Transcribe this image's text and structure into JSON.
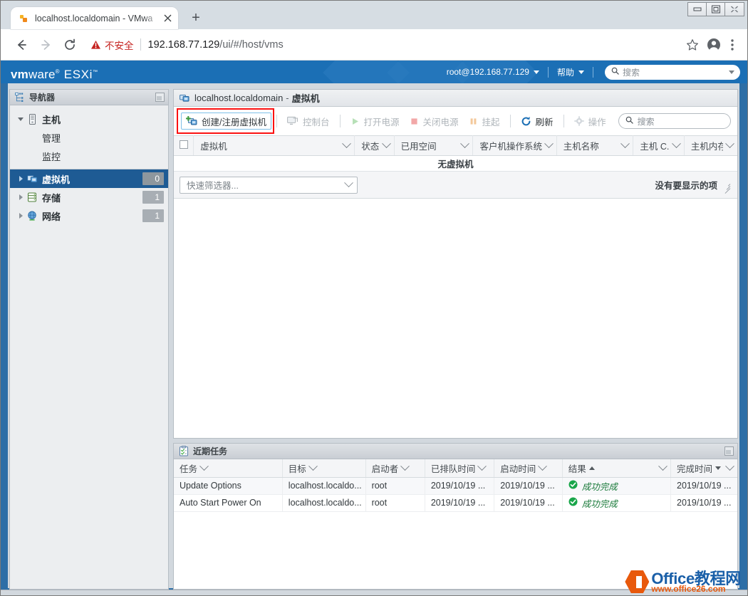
{
  "browser": {
    "tab": {
      "title": "localhost.localdomain - VMwa",
      "favicon_icon": "vmware-favicon-icon",
      "close_icon": "close-icon"
    },
    "new_tab_label": "+",
    "window_controls": {
      "minimize": "minimize-icon",
      "maximize": "maximize-icon",
      "close": "close-icon"
    },
    "nav": {
      "back_icon": "back-arrow-icon",
      "forward_icon": "forward-arrow-icon",
      "reload_icon": "reload-icon"
    },
    "omnibox": {
      "warning_icon": "warning-triangle-icon",
      "security_text": "不安全",
      "url_host": "192.168.77.129",
      "url_path": "/ui/#/host/vms"
    },
    "actions": {
      "bookmark_icon": "star-icon",
      "profile_icon": "account-avatar-icon",
      "menu_icon": "three-dot-menu-icon"
    }
  },
  "esxi_header": {
    "brand_vm": "vm",
    "brand_ware": "ware",
    "brand_reg": "®",
    "brand_product": "ESXi",
    "brand_tm": "™",
    "user": "root@192.168.77.129",
    "help": "帮助",
    "search_placeholder": "搜索",
    "search_icon": "search-icon",
    "accent_color": "#1b6fb5"
  },
  "navigator": {
    "title": "导航器",
    "title_icon": "navigator-icon",
    "minimize_icon": "panel-minimize-icon",
    "host": {
      "label": "主机",
      "icon": "host-server-icon",
      "expand_icon": "triangle-down-icon",
      "children": [
        {
          "label": "管理"
        },
        {
          "label": "监控"
        }
      ]
    },
    "items": [
      {
        "label": "虚拟机",
        "icon": "virtual-machine-icon",
        "count": "0",
        "selected": true
      },
      {
        "label": "存储",
        "icon": "storage-icon",
        "count": "1",
        "selected": false
      },
      {
        "label": "网络",
        "icon": "network-globe-icon",
        "count": "1",
        "selected": false
      }
    ]
  },
  "content": {
    "breadcrumb": {
      "icon": "virtual-machine-icon",
      "host": "localhost.localdomain",
      "separator": "-",
      "section": "虚拟机"
    },
    "toolbar": [
      {
        "label": "创建/注册虚拟机",
        "icon": "create-vm-icon",
        "disabled": false,
        "highlighted": true
      },
      {
        "label": "控制台",
        "icon": "console-icon",
        "disabled": true,
        "highlighted": false
      },
      {
        "label": "打开电源",
        "icon": "power-on-icon",
        "disabled": true,
        "highlighted": false
      },
      {
        "label": "关闭电源",
        "icon": "power-off-icon",
        "disabled": true,
        "highlighted": false
      },
      {
        "label": "挂起",
        "icon": "suspend-icon",
        "disabled": true,
        "highlighted": false
      },
      {
        "label": "刷新",
        "icon": "refresh-icon",
        "disabled": false,
        "highlighted": false
      },
      {
        "label": "操作",
        "icon": "actions-gear-icon",
        "disabled": true,
        "highlighted": false
      }
    ],
    "search_placeholder": "搜索",
    "search_icon": "search-icon",
    "table": {
      "select_all_icon": "checkbox-unchecked-icon",
      "columns": [
        "虚拟机",
        "状态",
        "已用空间",
        "客户机操作系统",
        "主机名称",
        "主机 C...",
        "主机内存"
      ],
      "empty_text": "无虚拟机",
      "rows": []
    },
    "filter": {
      "placeholder": "快速筛选器...",
      "dropdown_icon": "chevron-down-icon",
      "no_items_text": "没有要显示的项",
      "resize_icon": "resize-grip-icon"
    }
  },
  "tasks": {
    "title": "近期任务",
    "title_icon": "tasks-clipboard-icon",
    "minimize_icon": "panel-minimize-icon",
    "columns": [
      {
        "label": "任务",
        "sort": ""
      },
      {
        "label": "目标",
        "sort": ""
      },
      {
        "label": "启动者",
        "sort": ""
      },
      {
        "label": "已排队时间",
        "sort": ""
      },
      {
        "label": "启动时间",
        "sort": ""
      },
      {
        "label": "结果",
        "sort": "asc"
      },
      {
        "label": "完成时间",
        "sort": "desc"
      }
    ],
    "rows": [
      {
        "task": "Update Options",
        "target": "localhost.localdo...",
        "initiator": "root",
        "queued": "2019/10/19 ...",
        "started": "2019/10/19 ...",
        "result": "成功完成",
        "result_icon": "success-check-icon",
        "completed": "2019/10/19 ..."
      },
      {
        "task": "Auto Start Power On",
        "target": "localhost.localdo...",
        "initiator": "root",
        "queued": "2019/10/19 ...",
        "started": "2019/10/19 ...",
        "result": "成功完成",
        "result_icon": "success-check-icon",
        "completed": "2019/10/19 ..."
      }
    ]
  },
  "watermark": {
    "title": "Office教程网",
    "url": "www.office26.com",
    "icon": "office-hexagon-icon"
  }
}
